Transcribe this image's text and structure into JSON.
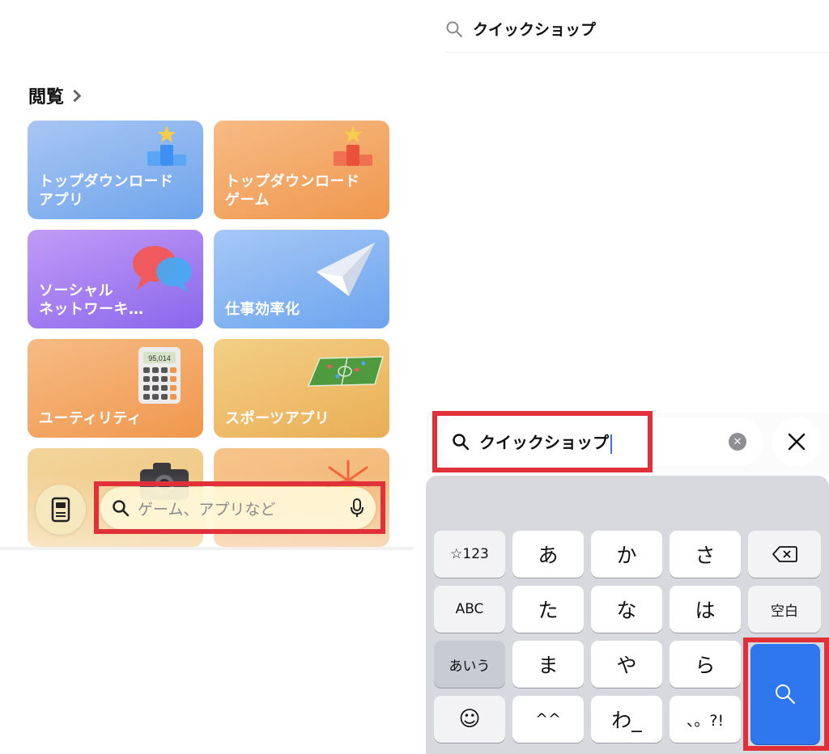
{
  "left_panel": {
    "section_title": "閲覧",
    "tiles": [
      {
        "label": "トップダウンロード\nアプリ",
        "icon": "podium-blue-icon",
        "color": "#6ea4ec"
      },
      {
        "label": "トップダウンロード\nゲーム",
        "icon": "podium-orange-icon",
        "color": "#f0974d"
      },
      {
        "label": "ソーシャル\nネットワーキ…",
        "icon": "speech-bubbles-icon",
        "color": "#8a67ec"
      },
      {
        "label": "仕事効率化",
        "icon": "paper-plane-icon",
        "color": "#6ba4ee"
      },
      {
        "label": "ユーティリティ",
        "icon": "calculator-icon",
        "color": "#f0974d"
      },
      {
        "label": "スポーツアプリ",
        "icon": "soccer-field-icon",
        "color": "#eaae55"
      },
      {
        "label": "",
        "icon": "camera-icon",
        "color": "#f0c277"
      },
      {
        "label": "",
        "icon": "fireworks-icon",
        "color": "#f1b06a"
      }
    ],
    "calculator_display": "95,014",
    "search_placeholder": "ゲーム、アプリなど"
  },
  "right_panel": {
    "top_query": "クイックショップ",
    "search_field_value": "クイックショップ",
    "keyboard": {
      "rows": [
        [
          "☆123",
          "あ",
          "か",
          "さ",
          "⌫"
        ],
        [
          "ABC",
          "た",
          "な",
          "は",
          "空白"
        ],
        [
          "あいう",
          "ま",
          "や",
          "ら"
        ],
        [
          "☺",
          "^^",
          "わ_",
          "、。?!"
        ]
      ],
      "search_key_icon": "search-icon"
    }
  },
  "colors": {
    "highlight_red": "#e0303a",
    "accent_blue": "#2f77ef"
  }
}
